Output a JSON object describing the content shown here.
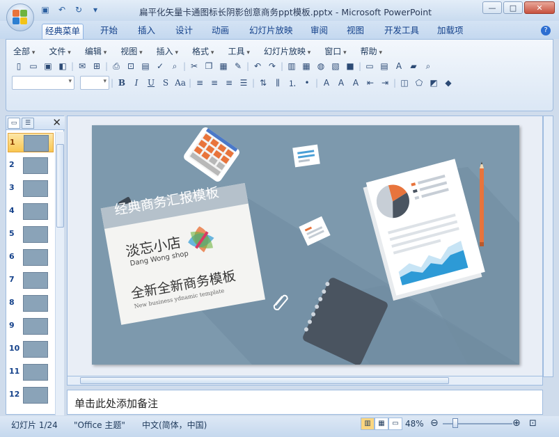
{
  "window": {
    "title": "扁平化矢量卡通图标长阴影创意商务ppt模板.pptx - Microsoft PowerPoint",
    "controls": [
      "—",
      "□",
      "✕"
    ]
  },
  "qat": {
    "items": [
      "save",
      "undo",
      "redo",
      "customize"
    ]
  },
  "tabs": [
    {
      "label": "经典菜单",
      "active": true
    },
    {
      "label": "开始",
      "active": false
    },
    {
      "label": "插入",
      "active": false
    },
    {
      "label": "设计",
      "active": false
    },
    {
      "label": "动画",
      "active": false
    },
    {
      "label": "幻灯片放映",
      "active": false
    },
    {
      "label": "审阅",
      "active": false
    },
    {
      "label": "视图",
      "active": false
    },
    {
      "label": "开发工具",
      "active": false
    },
    {
      "label": "加载项",
      "active": false
    }
  ],
  "menus": [
    "全部",
    "文件",
    "编辑",
    "视图",
    "插入",
    "格式",
    "工具",
    "幻灯片放映",
    "窗口",
    "帮助"
  ],
  "slides_pane": {
    "slides": [
      {
        "num": "1",
        "selected": true
      },
      {
        "num": "2",
        "selected": false
      },
      {
        "num": "3",
        "selected": false
      },
      {
        "num": "4",
        "selected": false
      },
      {
        "num": "5",
        "selected": false
      },
      {
        "num": "6",
        "selected": false
      },
      {
        "num": "7",
        "selected": false
      },
      {
        "num": "8",
        "selected": false
      },
      {
        "num": "9",
        "selected": false
      },
      {
        "num": "10",
        "selected": false
      },
      {
        "num": "11",
        "selected": false
      },
      {
        "num": "12",
        "selected": false
      }
    ]
  },
  "slide": {
    "banner": "经典商务汇报模板",
    "shop_name": "淡忘小店",
    "shop_name_en": "Dang Wong shop",
    "headline": "全新全新商务模板",
    "subline": "New business ydnamic template"
  },
  "notes": {
    "placeholder": "单击此处添加备注"
  },
  "status": {
    "slide_info": "幻灯片 1/24",
    "theme": "\"Office 主题\"",
    "language": "中文(简体，中国)",
    "zoom": "48%"
  },
  "colors": {
    "slide_bg": "#7d99ad",
    "accent_orange": "#e8743c",
    "dark_slate": "#4a5460",
    "selection": "#f9c650"
  }
}
